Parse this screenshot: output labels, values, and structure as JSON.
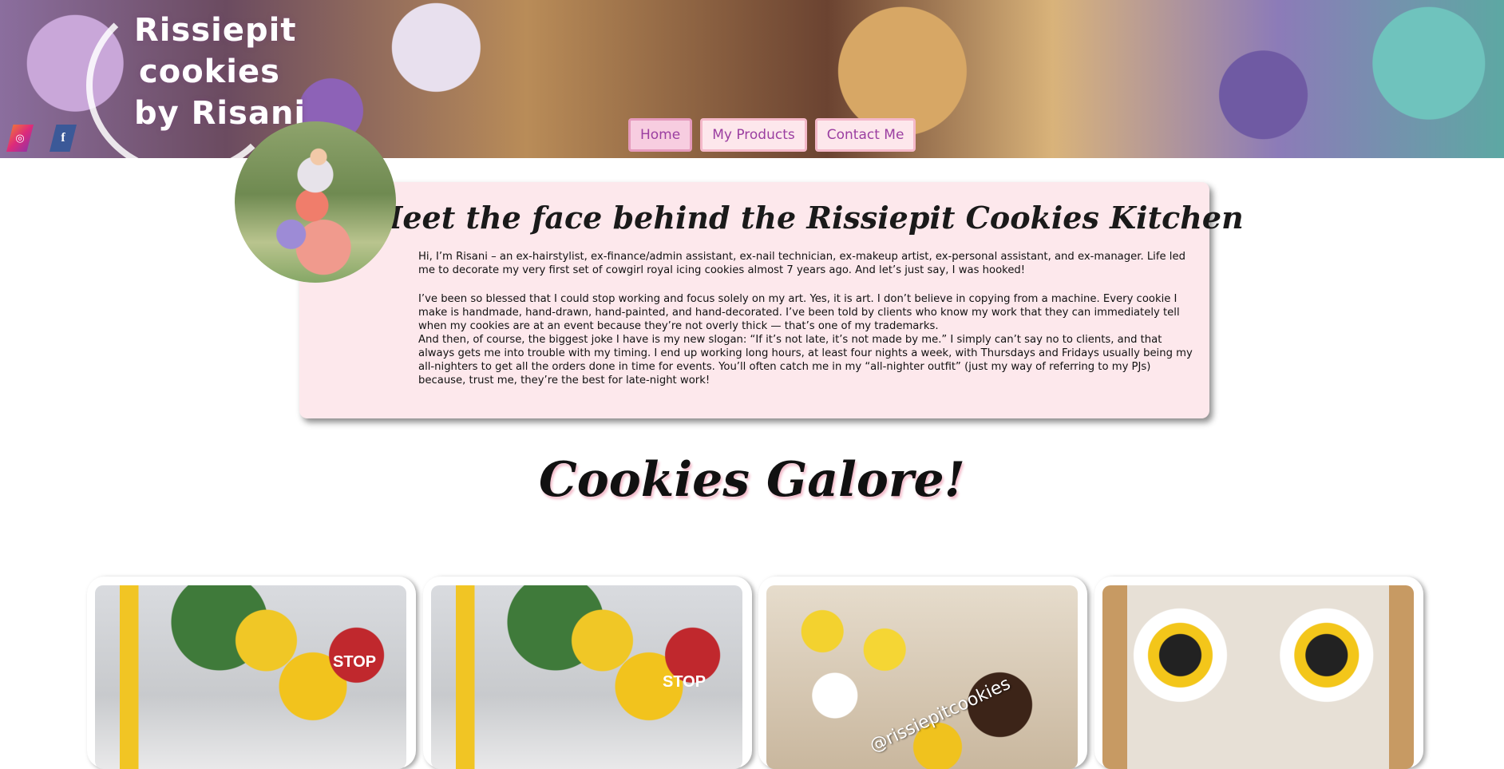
{
  "brand": {
    "logo_lines": [
      "Rissiepit",
      "cookies",
      "by Risani"
    ]
  },
  "social": {
    "instagram_icon": "instagram-icon",
    "facebook_icon": "facebook-icon",
    "instagram_glyph": "◎",
    "facebook_glyph": "f"
  },
  "nav": {
    "items": [
      {
        "label": "Home",
        "active": true
      },
      {
        "label": "My Products",
        "active": false
      },
      {
        "label": "Contact Me",
        "active": false
      }
    ]
  },
  "about": {
    "title": "Meet the face behind the Rissiepit Cookies Kitchen",
    "paragraphs": [
      "Hi, I’m Risani – an ex-hairstylist, ex-finance/admin assistant, ex-nail technician, ex-makeup artist, ex-personal assistant, and ex-manager. Life led me to decorate my very first set of cowgirl royal icing cookies almost 7 years ago. And let’s just say, I was hooked!",
      "I’ve been so blessed that I could stop working and focus solely on my art. Yes, it is art. I don’t believe in copying from a machine. Every cookie I make is handmade, hand-drawn, hand-painted, and hand-decorated. I’ve been told by clients who know my work that they can immediately tell when my cookies are at an event because they’re not overly thick — that’s one of my trademarks.",
      "And then, of course, the biggest joke I have is my new slogan: “If it’s not late, it’s not made by me.” I simply can’t say no to clients, and that always gets me into trouble with my timing. I end up working long hours, at least four nights a week, with Thursdays and Fridays usually being my all-nighters to get all the orders done in time for events. You’ll often catch me in my “all-nighter outfit” (just my way of referring to my PJs) because, trust me, they’re the best for late-night work!"
    ]
  },
  "gallery": {
    "title": "Cookies Galore!",
    "cards": [
      {
        "image": "construction-cake",
        "sign_text": "STOP"
      },
      {
        "image": "construction-cake",
        "sign_text": "STOP"
      },
      {
        "image": "sunflower-cupcakes",
        "watermark": "@rissiepitcookies"
      },
      {
        "image": "sunflower-thank-you-cookies"
      }
    ]
  },
  "colors": {
    "accent_pink": "#fde8ec",
    "nav_text": "#9b3fa1",
    "nav_border": "#f4b8c9"
  }
}
